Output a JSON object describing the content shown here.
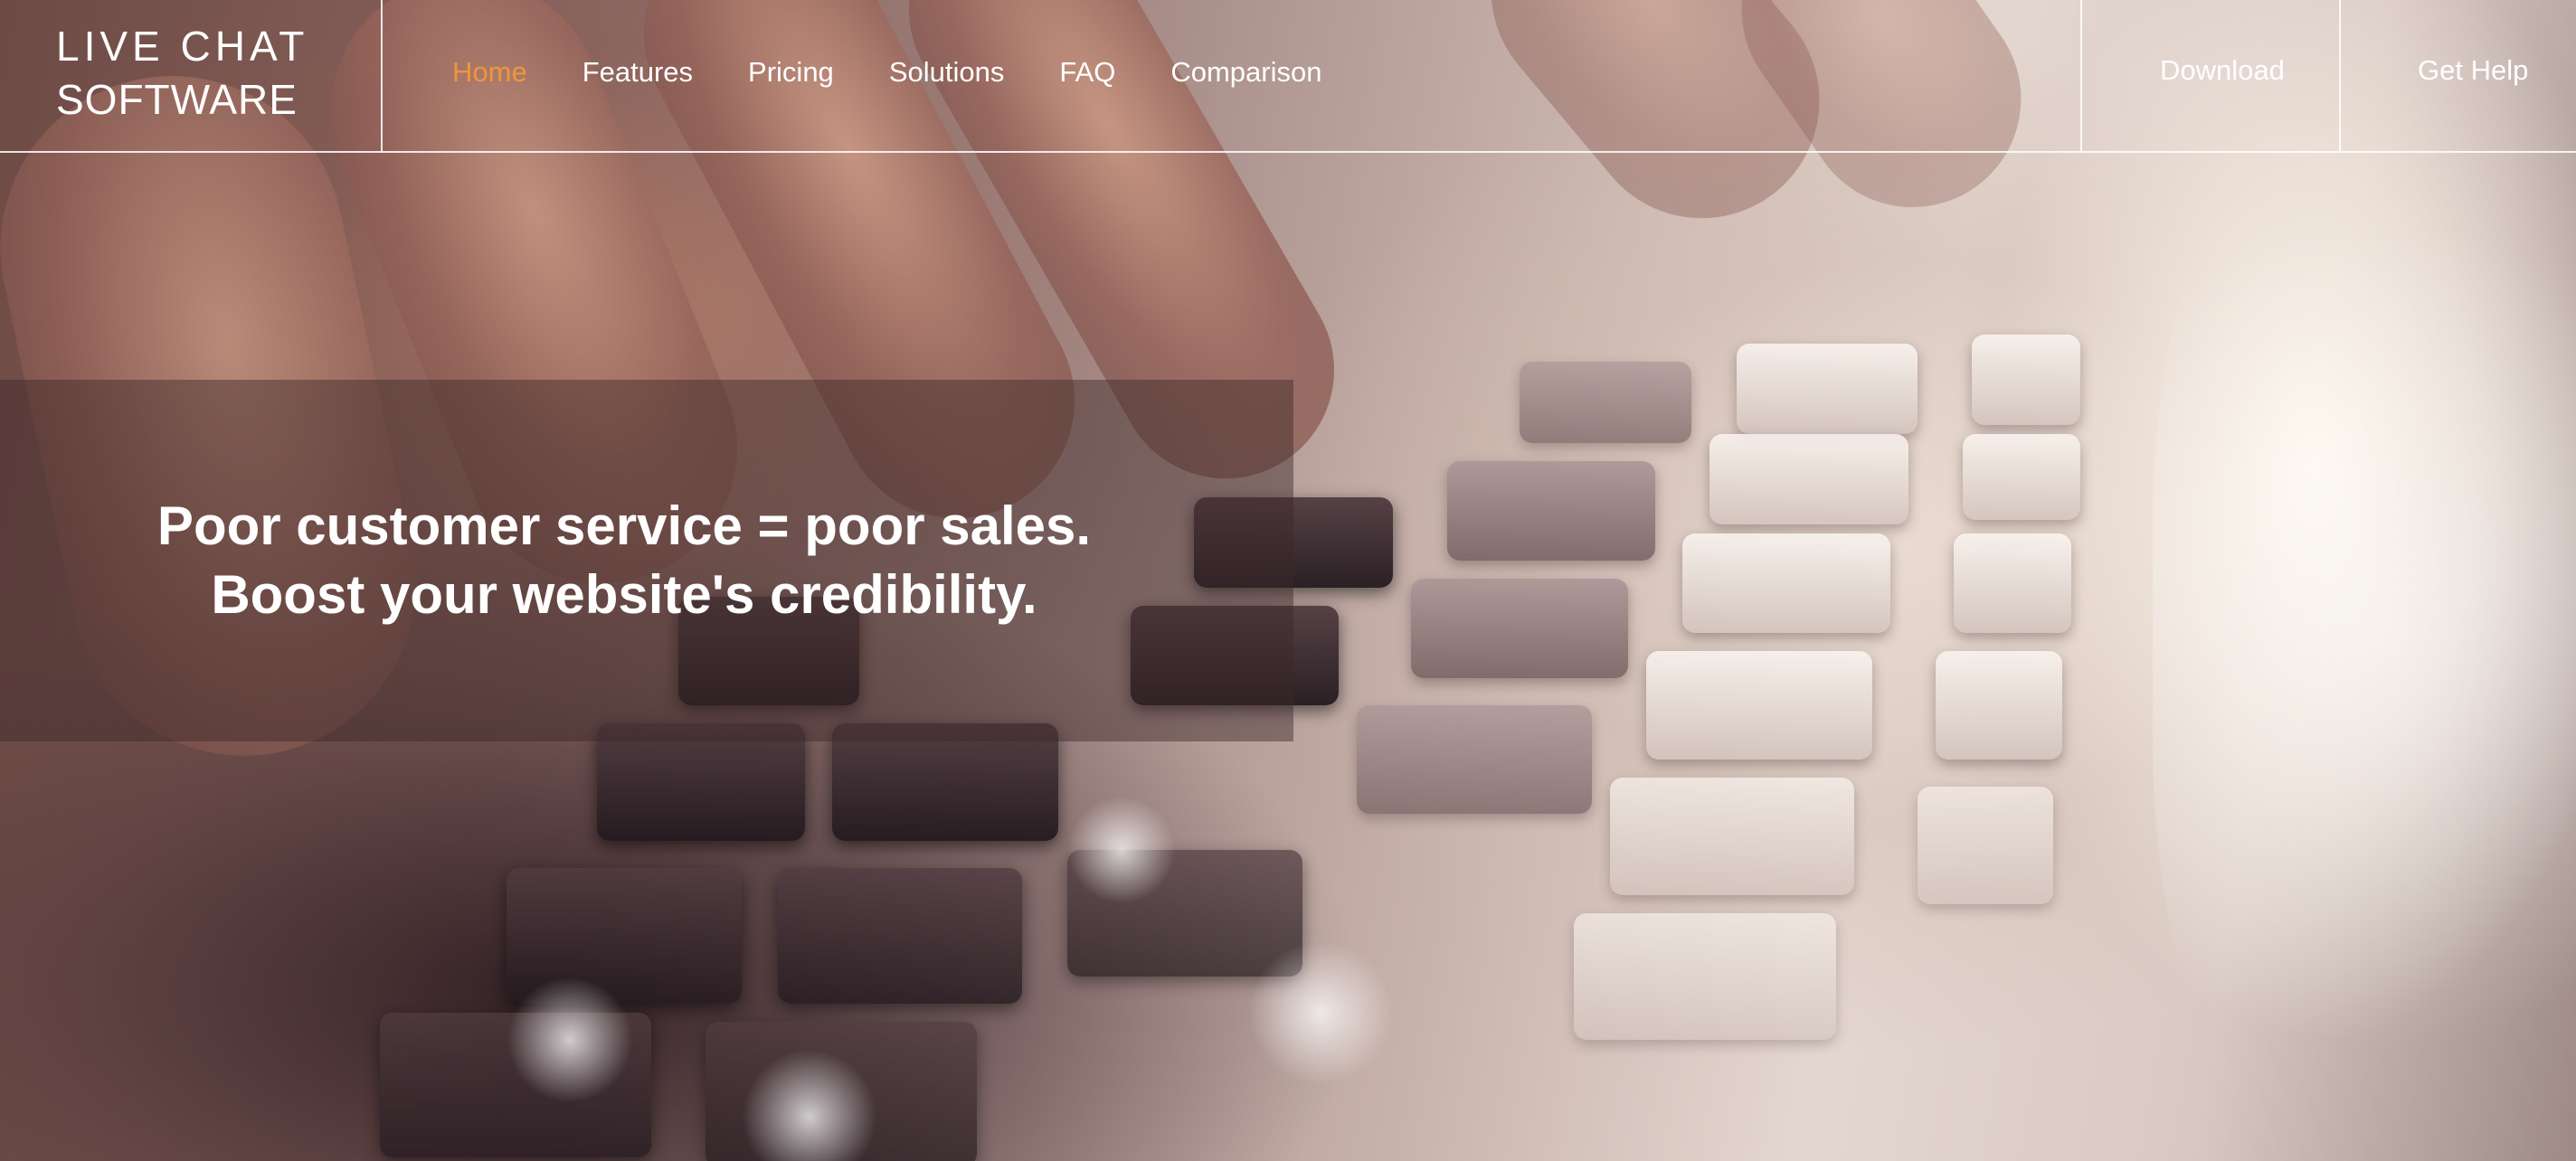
{
  "logo": {
    "line1": "LIVE CHAT",
    "line2": "SOFTWARE"
  },
  "nav": {
    "items": [
      {
        "label": "Home",
        "active": true
      },
      {
        "label": "Features",
        "active": false
      },
      {
        "label": "Pricing",
        "active": false
      },
      {
        "label": "Solutions",
        "active": false
      },
      {
        "label": "FAQ",
        "active": false
      },
      {
        "label": "Comparison",
        "active": false
      }
    ],
    "download_label": "Download",
    "help_label": "Get Help"
  },
  "hero": {
    "line1": "Poor customer service = poor sales.",
    "line2": "Boost your website's credibility."
  },
  "colors": {
    "accent": "#f0963a",
    "text": "#ffffff",
    "panel": "rgba(60,40,40,0.45)"
  }
}
